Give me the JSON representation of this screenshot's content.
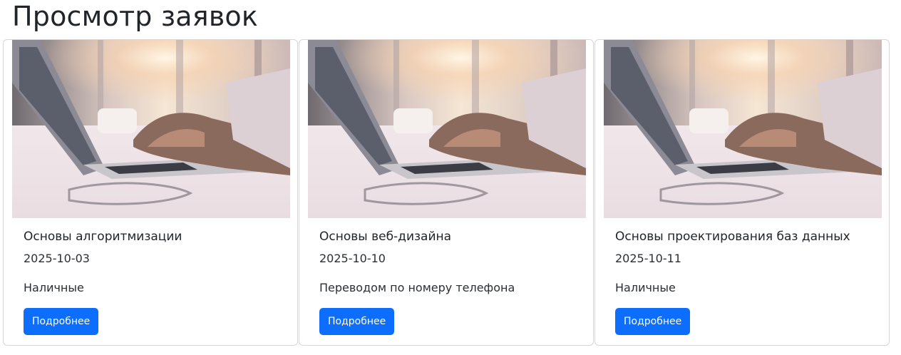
{
  "page": {
    "title": "Просмотр заявок"
  },
  "cards": [
    {
      "title": "Основы алгоритмизации",
      "date": "2025-10-03",
      "payment": "Наличные",
      "button_label": "Подробнее"
    },
    {
      "title": "Основы веб-дизайна",
      "date": "2025-10-10",
      "payment": "Переводом по номеру телефона",
      "button_label": "Подробнее"
    },
    {
      "title": "Основы проектирования баз данных",
      "date": "2025-10-11",
      "payment": "Наличные",
      "button_label": "Подробнее"
    }
  ],
  "colors": {
    "primary_button": "#0d6efd",
    "text": "#212529",
    "card_border": "#d6d6d6"
  }
}
